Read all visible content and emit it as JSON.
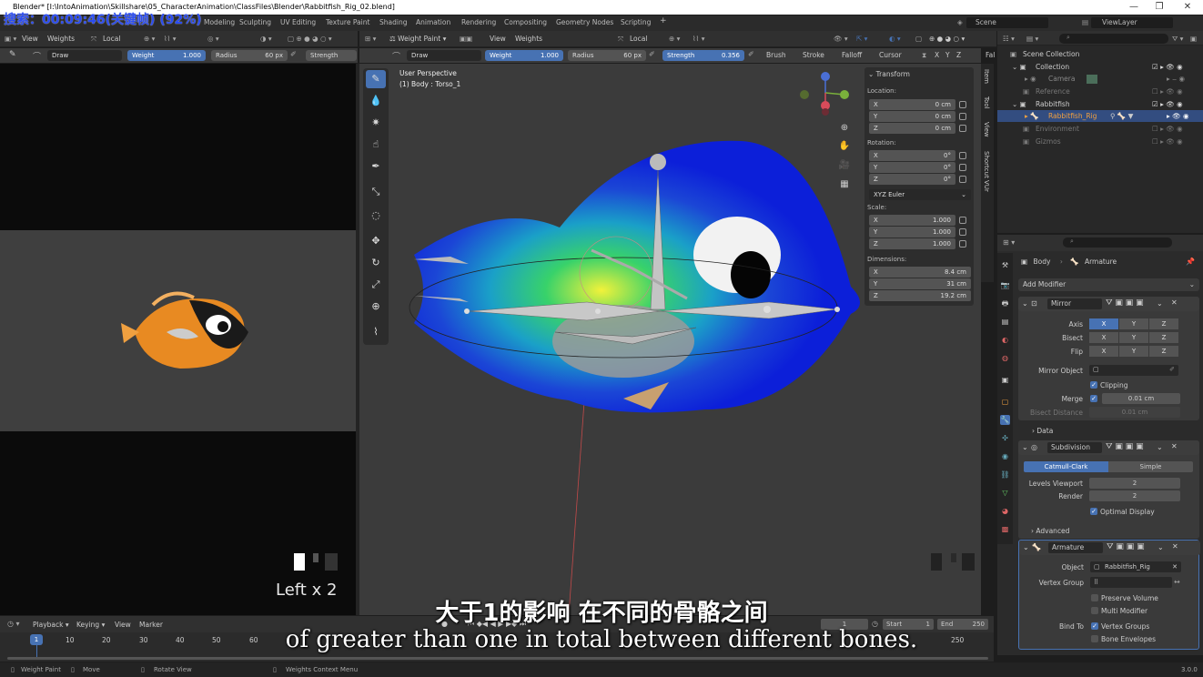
{
  "title_bar": {
    "text": "Blender* [I:\\IntoAnimation\\Skillshare\\05_CharacterAnimation\\ClassFiles\\Blender\\Rabbitfish_Rig_02.blend]",
    "minimize": "—",
    "restore": "❐",
    "close": "✕"
  },
  "search_overlay": "搜索：00:09:46(关键帧) (92%)",
  "menu": {
    "workspaces": [
      "Modeling",
      "Sculpting",
      "UV Editing",
      "Texture Paint",
      "Shading",
      "Animation",
      "Rendering",
      "Compositing",
      "Geometry Nodes",
      "Scripting"
    ],
    "add": "+",
    "scene": "Scene",
    "view_layer": "ViewLayer"
  },
  "left_header": {
    "view": "View",
    "weights": "Weights",
    "orientation": "Local"
  },
  "left_tool": {
    "tool": "Draw",
    "weight_label": "Weight",
    "weight_value": "1.000",
    "radius_label": "Radius",
    "radius_value": "60 px",
    "strength_label": "Strength"
  },
  "left_overlay": {
    "keys": "Left x 2"
  },
  "viewport_header": {
    "mode": "Weight Paint",
    "view": "View",
    "weights": "Weights",
    "orientation": "Local"
  },
  "viewport_tool": {
    "tool": "Draw",
    "weight_label": "Weight",
    "weight_value": "1.000",
    "radius_label": "Radius",
    "radius_value": "60 px",
    "strength_label": "Strength",
    "strength_value": "0.356",
    "brush": "Brush",
    "stroke": "Stroke",
    "falloff": "Falloff",
    "cursor": "Cursor",
    "x": "X",
    "y": "Y",
    "z": "Z",
    "fal": "Fal"
  },
  "viewport_info": {
    "perspective": "User Perspective",
    "object": "(1) Body : Torso_1"
  },
  "n_panel": {
    "header": "Transform",
    "location_label": "Location:",
    "loc_x": "0 cm",
    "loc_y": "0 cm",
    "loc_z": "0 cm",
    "rotation_label": "Rotation:",
    "rot_x": "0°",
    "rot_y": "0°",
    "rot_z": "0°",
    "rotation_mode": "XYZ Euler",
    "scale_label": "Scale:",
    "scale_x": "1.000",
    "scale_y": "1.000",
    "scale_z": "1.000",
    "dimensions_label": "Dimensions:",
    "dim_x": "8.4 cm",
    "dim_y": "31 cm",
    "dim_z": "19.2 cm",
    "axis_x": "X",
    "axis_y": "Y",
    "axis_z": "Z"
  },
  "side_tabs": [
    "Item",
    "Tool",
    "View",
    "Shortcut VUr"
  ],
  "outliner": {
    "search_placeholder": "",
    "rows": [
      {
        "label": "Scene Collection"
      },
      {
        "label": "Collection"
      },
      {
        "label": "Camera"
      },
      {
        "label": "Reference"
      },
      {
        "label": "Rabbitfish"
      },
      {
        "label": "Rabbitfish_Rig"
      },
      {
        "label": "Environment"
      },
      {
        "label": "Gizmos"
      }
    ]
  },
  "properties": {
    "breadcrumb_object": "Body",
    "breadcrumb_data": "Armature",
    "add_modifier": "Add Modifier",
    "mirror": {
      "name": "Mirror",
      "axis_label": "Axis",
      "bisect_label": "Bisect",
      "flip_label": "Flip",
      "x": "X",
      "y": "Y",
      "z": "Z",
      "mirror_object_label": "Mirror Object",
      "clipping": "Clipping",
      "merge_label": "Merge",
      "merge_value": "0.01 cm",
      "bisect_distance_label": "Bisect Distance",
      "bisect_distance_value": "0.01 cm",
      "data": "Data"
    },
    "subdivision": {
      "name": "Subdivision",
      "catmull": "Catmull-Clark",
      "simple": "Simple",
      "levels_label": "Levels Viewport",
      "levels_value": "2",
      "render_label": "Render",
      "render_value": "2",
      "optimal": "Optimal Display",
      "advanced": "Advanced"
    },
    "armature": {
      "name": "Armature",
      "object_label": "Object",
      "object_value": "Rabbitfish_Rig",
      "vertex_group_label": "Vertex Group",
      "preserve_volume": "Preserve Volume",
      "multi_modifier": "Multi Modifier",
      "bind_to_label": "Bind To",
      "vertex_groups": "Vertex Groups",
      "bone_envelopes": "Bone Envelopes"
    }
  },
  "timeline": {
    "playback": "Playback",
    "keying": "Keying",
    "view": "View",
    "marker": "Marker",
    "current_frame": "1",
    "start_label": "Start",
    "start_value": "1",
    "end_label": "End",
    "end_value": "250",
    "ticks": [
      "1",
      "10",
      "20",
      "30",
      "40",
      "50",
      "60",
      "250"
    ]
  },
  "status_bar": {
    "weight_paint": "Weight Paint",
    "move": "Move",
    "rotate_view": "Rotate View",
    "context_menu": "Weights Context Menu",
    "version": "3.0.0"
  },
  "subtitles": {
    "chinese": "大于1的影响 在不同的骨骼之间",
    "english": "of greater than one in total between different bones."
  }
}
